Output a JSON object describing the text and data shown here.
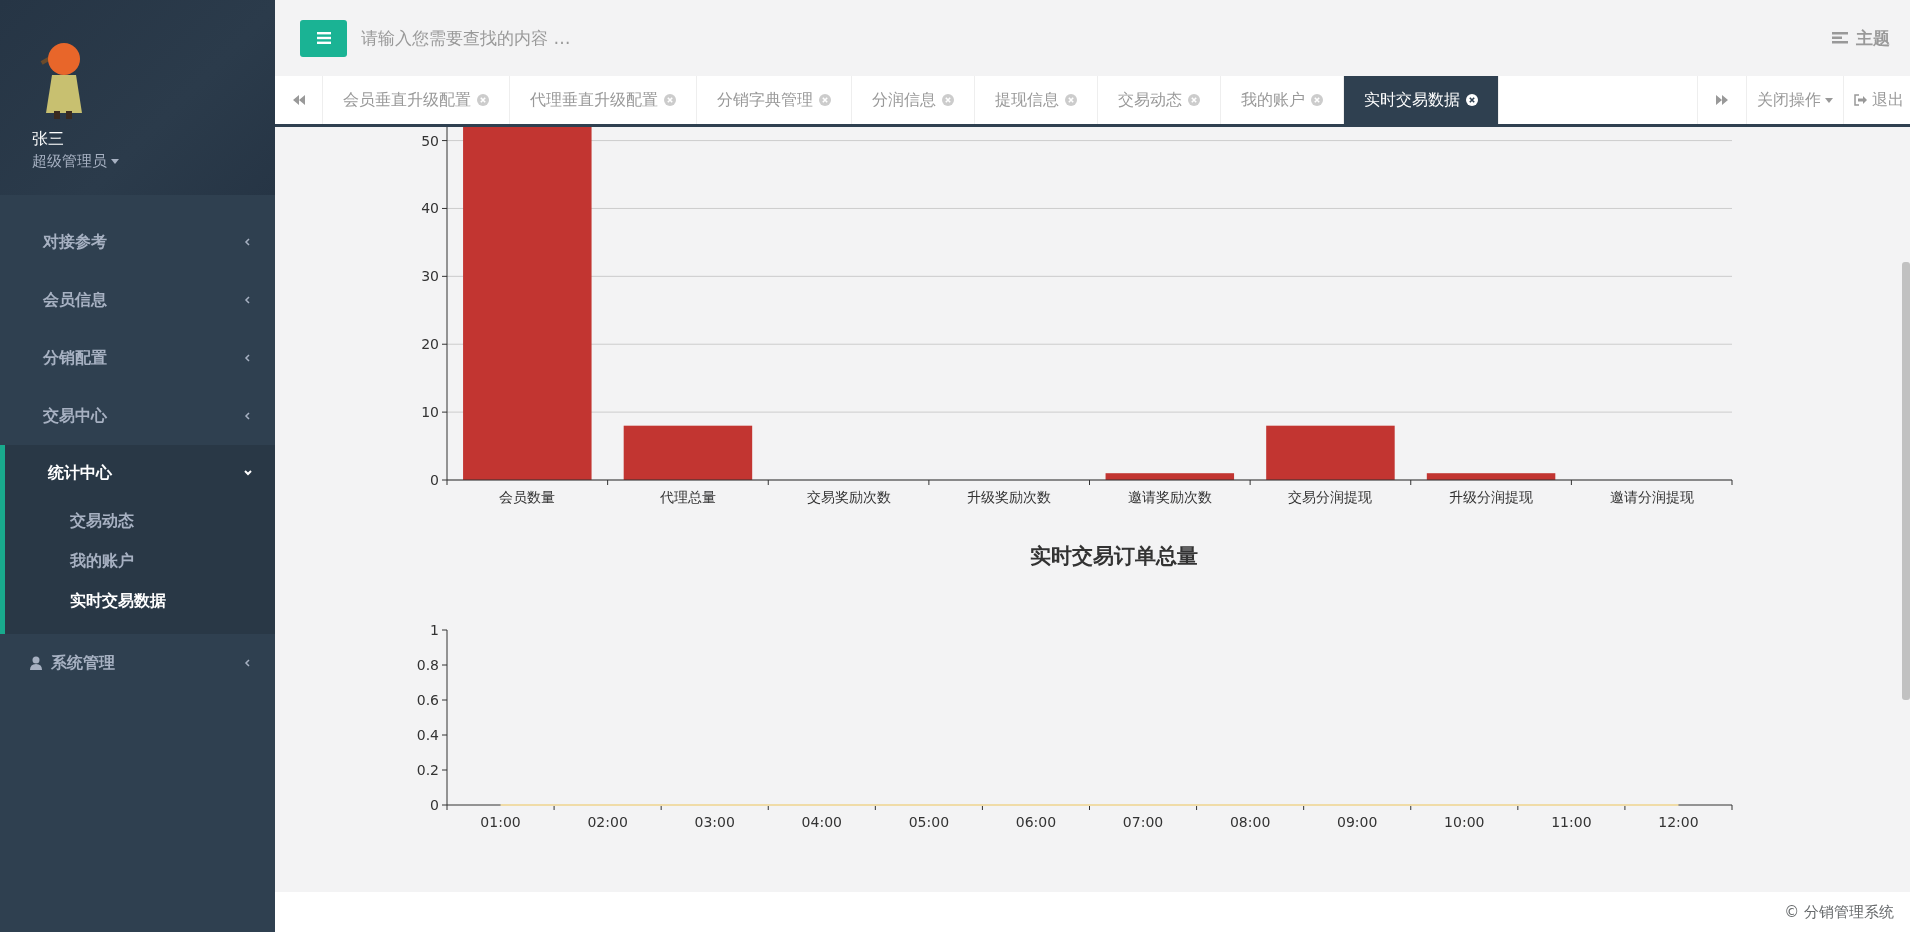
{
  "user": {
    "name": "张三",
    "role": "超级管理员"
  },
  "menu": [
    {
      "label": "对接参考",
      "kind": "plain",
      "expanded": false
    },
    {
      "label": "会员信息",
      "kind": "plain",
      "expanded": false
    },
    {
      "label": "分销配置",
      "kind": "plain",
      "expanded": false
    },
    {
      "label": "交易中心",
      "kind": "plain",
      "expanded": false
    },
    {
      "label": "统计中心",
      "kind": "plain",
      "expanded": true,
      "children": [
        {
          "label": "交易动态",
          "selected": false
        },
        {
          "label": "我的账户",
          "selected": false
        },
        {
          "label": "实时交易数据",
          "selected": true
        }
      ]
    },
    {
      "label": "系统管理",
      "kind": "person",
      "expanded": false
    }
  ],
  "header": {
    "search": {
      "placeholder": "请输入您需要查找的内容 …"
    },
    "theme": "主题"
  },
  "tabs": [
    {
      "label": "会员垂直升级配置",
      "selected": false
    },
    {
      "label": "代理垂直升级配置",
      "selected": false
    },
    {
      "label": "分销字典管理",
      "selected": false
    },
    {
      "label": "分润信息",
      "selected": false
    },
    {
      "label": "提现信息",
      "selected": false
    },
    {
      "label": "交易动态",
      "selected": false
    },
    {
      "label": "我的账户",
      "selected": false
    },
    {
      "label": "实时交易数据",
      "selected": true
    }
  ],
  "tab_actions": {
    "close_ops": "关闭操作",
    "logout": "退出"
  },
  "bar_chart": {
    "chart_data": {
      "type": "bar",
      "categories": [
        "会员数量",
        "代理总量",
        "交易奖励次数",
        "升级奖励次数",
        "邀请奖励次数",
        "交易分润提现",
        "升级分润提现",
        "邀请分润提现"
      ],
      "series": [
        {
          "color": "#c23531",
          "values": [
            52,
            8,
            0,
            0,
            1,
            8,
            1,
            0
          ]
        }
      ],
      "ylim": [
        0,
        52
      ],
      "yticks": [
        0,
        10,
        20,
        30,
        40,
        50
      ],
      "grid": true
    }
  },
  "line_chart": {
    "chart_data": {
      "type": "line",
      "title": "实时交易订单总量",
      "categories": [
        "01:00",
        "02:00",
        "03:00",
        "04:00",
        "05:00",
        "06:00",
        "07:00",
        "08:00",
        "09:00",
        "10:00",
        "11:00",
        "12:00"
      ],
      "series": [
        {
          "color": "#f0dca8",
          "values": [
            0,
            0,
            0,
            0,
            0,
            0,
            0,
            0,
            0,
            0,
            0,
            0
          ]
        }
      ],
      "ylim": [
        0,
        1
      ],
      "yticks": [
        0,
        0.2,
        0.4,
        0.6,
        0.8,
        1
      ]
    }
  },
  "footer": "© 分销管理系统"
}
